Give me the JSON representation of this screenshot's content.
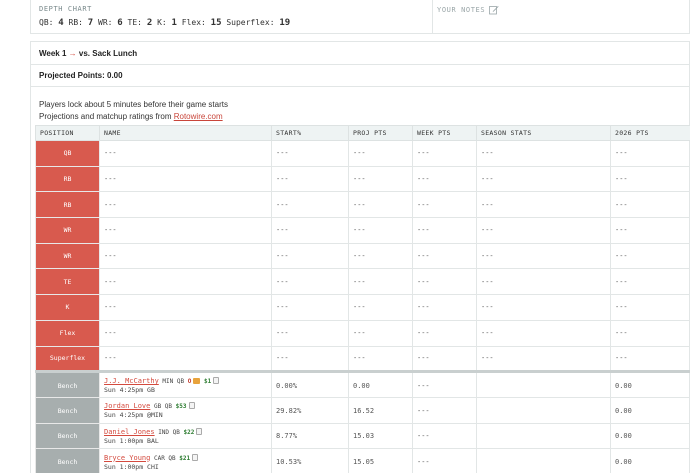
{
  "depth_chart": {
    "title": "DEPTH CHART",
    "counts": [
      {
        "label": "QB:",
        "value": "4"
      },
      {
        "label": "RB:",
        "value": "7"
      },
      {
        "label": "WR:",
        "value": "6"
      },
      {
        "label": "TE:",
        "value": "2"
      },
      {
        "label": "K:",
        "value": "1"
      },
      {
        "label": "Flex:",
        "value": "15"
      },
      {
        "label": "Superflex:",
        "value": "19"
      }
    ]
  },
  "notes": {
    "title": "YOUR NOTES",
    "icon": "edit-icon"
  },
  "lineup": {
    "week_label": "Week 1",
    "arrow": "→",
    "opponent": "vs. Sack Lunch",
    "projected_points": "Projected Points: 0.00",
    "info_line1": "Players lock about 5 minutes before their game starts",
    "info_line2_prefix": "Projections and matchup ratings from ",
    "info_link": "Rotowire.com"
  },
  "table": {
    "headers": [
      "POSITION",
      "NAME",
      "START%",
      "PROJ PTS",
      "WEEK PTS",
      "SEASON STATS",
      "2026 PTS"
    ],
    "starters": [
      {
        "pos": "QB",
        "name": "---",
        "start": "---",
        "proj": "---",
        "week": "---",
        "season": "---",
        "pts2026": "---"
      },
      {
        "pos": "RB",
        "name": "---",
        "start": "---",
        "proj": "---",
        "week": "---",
        "season": "---",
        "pts2026": "---"
      },
      {
        "pos": "RB",
        "name": "---",
        "start": "---",
        "proj": "---",
        "week": "---",
        "season": "---",
        "pts2026": "---"
      },
      {
        "pos": "WR",
        "name": "---",
        "start": "---",
        "proj": "---",
        "week": "---",
        "season": "---",
        "pts2026": "---"
      },
      {
        "pos": "WR",
        "name": "---",
        "start": "---",
        "proj": "---",
        "week": "---",
        "season": "---",
        "pts2026": "---"
      },
      {
        "pos": "TE",
        "name": "---",
        "start": "---",
        "proj": "---",
        "week": "---",
        "season": "---",
        "pts2026": "---"
      },
      {
        "pos": "K",
        "name": "---",
        "start": "---",
        "proj": "---",
        "week": "---",
        "season": "---",
        "pts2026": "---"
      },
      {
        "pos": "Flex",
        "name": "---",
        "start": "---",
        "proj": "---",
        "week": "---",
        "season": "---",
        "pts2026": "---"
      },
      {
        "pos": "Superflex",
        "name": "---",
        "start": "---",
        "proj": "---",
        "week": "---",
        "season": "---",
        "pts2026": "---"
      }
    ],
    "bench": [
      {
        "pos": "Bench",
        "name": "J.J. McCarthy",
        "team": "MIN",
        "position": "QB",
        "injury": "O",
        "salary": "$1",
        "game": "Sun 4:25pm GB",
        "start": "0.00%",
        "proj": "0.00",
        "week": "---",
        "season": "",
        "pts2026": "0.00"
      },
      {
        "pos": "Bench",
        "name": "Jordan Love",
        "team": "GB",
        "position": "QB",
        "injury": "",
        "salary": "$53",
        "game": "Sun 4:25pm @MIN",
        "start": "29.82%",
        "proj": "16.52",
        "week": "---",
        "season": "",
        "pts2026": "0.00"
      },
      {
        "pos": "Bench",
        "name": "Daniel Jones",
        "team": "IND",
        "position": "QB",
        "injury": "",
        "salary": "$22",
        "game": "Sun 1:00pm BAL",
        "start": "8.77%",
        "proj": "15.03",
        "week": "---",
        "season": "",
        "pts2026": "0.00"
      },
      {
        "pos": "Bench",
        "name": "Bryce Young",
        "team": "CAR",
        "position": "QB",
        "injury": "",
        "salary": "$21",
        "game": "Sun 1:00pm CHI",
        "start": "10.53%",
        "proj": "15.05",
        "week": "---",
        "season": "",
        "pts2026": "0.00"
      }
    ]
  }
}
